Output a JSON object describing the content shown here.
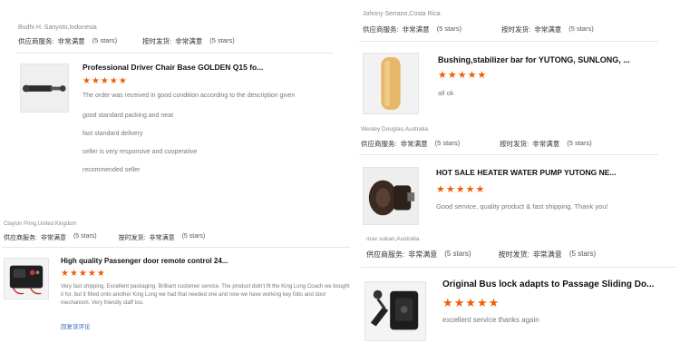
{
  "labels": {
    "supplier_service": "供应商服务:",
    "shipping_speed": "按时发货:",
    "very_satisfied": "非常满意",
    "five_stars": "(5 stars)"
  },
  "colors": {
    "star": "#f25c05",
    "link": "#3a6fb5"
  },
  "reviews": [
    {
      "reviewer": "Budhi H. Sanyoto,Indonesia",
      "product_title": "Professional Driver Chair Base GOLDEN Q15 fo...",
      "stars": "★★★★★",
      "rating": 5,
      "lines": [
        "The order was received in good condition according to the description given",
        "good standard packing and neat",
        "fast standard delivery",
        "seller is very responsive and cooperative",
        "recommended seller"
      ],
      "thumb_icon": "shock-absorber-icon"
    },
    {
      "reviewer": "Clayton Pring,United Kingdom",
      "product_title": "High quality Passenger door remote control 24...",
      "stars": "★★★★★",
      "rating": 5,
      "text": "Very fast shipping.  Excellent packaging.  Brilliant customer service.  The product didn't fit the King Long Coach we bought it for, but it fitted onto another King Long we had that needed one and now we have working key fobs and door mechanism.  Very friendly staff too.",
      "link": "回复该评论",
      "thumb_icon": "remote-control-box-icon"
    },
    {
      "reviewer": "Johnny Serrano,Costa Rica",
      "product_title": "Bushing,stabilizer bar for YUTONG, SUNLONG, ...",
      "stars": "★★★★★",
      "rating": 5,
      "text": "all ok",
      "thumb_icon": "bushing-icon"
    },
    {
      "reviewer": "Wesley Douglas,Australia",
      "product_title": "HOT SALE HEATER WATER PUMP YUTONG NE...",
      "stars": "★★★★★",
      "rating": 5,
      "text": "Good service, quality product & fast shipping. Thank you!",
      "thumb_icon": "water-pump-icon"
    },
    {
      "reviewer": "max sukan,Australia",
      "product_title": "Original Bus lock adapts to Passage Sliding Do...",
      "stars": "★★★★★",
      "rating": 5,
      "text": "excellent service thanks again",
      "thumb_icon": "door-lock-icon"
    }
  ]
}
